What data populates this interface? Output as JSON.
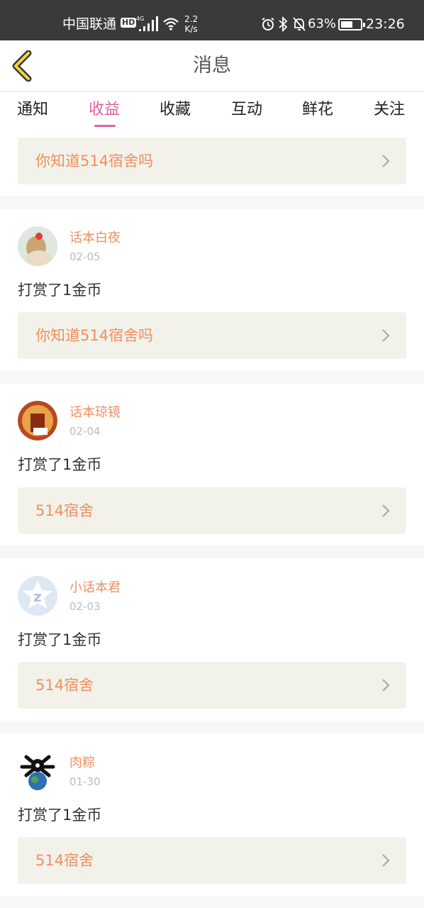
{
  "status_bar": {
    "carrier": "中国联通",
    "hd_badge": "HD",
    "network_speed_value": "2.2",
    "network_speed_unit": "K/s",
    "battery": "63%",
    "battery_level": 0.63,
    "time": "23:26",
    "icons": [
      "signal-4g-icon",
      "wifi-icon",
      "alarm-icon",
      "bluetooth-icon",
      "mute-bell-icon",
      "battery-icon"
    ]
  },
  "header": {
    "title": "消息",
    "back_icon": "chevron-left-icon"
  },
  "tabs": [
    {
      "label": "通知",
      "active": false
    },
    {
      "label": "收益",
      "active": true
    },
    {
      "label": "收藏",
      "active": false
    },
    {
      "label": "互动",
      "active": false
    },
    {
      "label": "鲜花",
      "active": false
    },
    {
      "label": "关注",
      "active": false
    }
  ],
  "colors": {
    "accent": "#e2609f",
    "name": "#ee9060",
    "link_bg": "#f3f2ea"
  },
  "messages": [
    {
      "link": "你知道514宿舍吗"
    },
    {
      "user": "话本白夜",
      "date": "02-05",
      "action": "打赏了1金币",
      "link": "你知道514宿舍吗"
    },
    {
      "user": "话本琼镜",
      "date": "02-04",
      "action": "打赏了1金币",
      "link": "514宿舍"
    },
    {
      "user": "小话本君",
      "date": "02-03",
      "action": "打赏了1金币",
      "link": "514宿舍"
    },
    {
      "user": "肉粽",
      "date": "01-30",
      "action": "打赏了1金币",
      "link": "514宿舍"
    }
  ]
}
